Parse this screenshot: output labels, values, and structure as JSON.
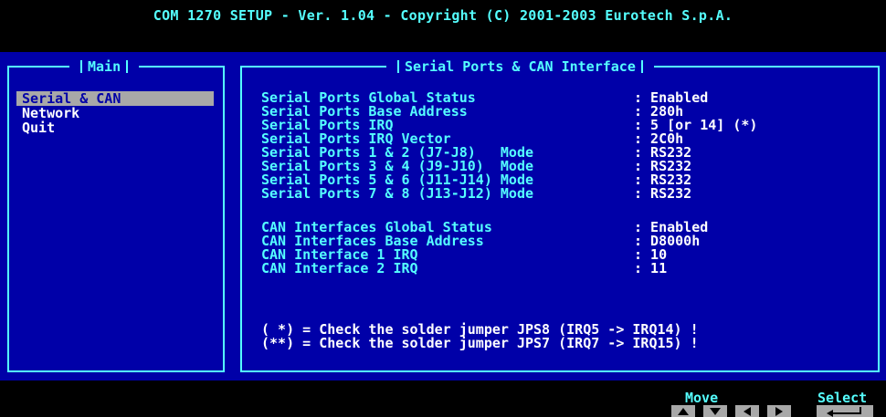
{
  "header": {
    "title": "COM 1270 SETUP - Ver. 1.04 - Copyright (C) 2001-2003 Eurotech S.p.A."
  },
  "main_panel": {
    "title": "Main",
    "items": [
      {
        "label": "Serial & CAN",
        "selected": true
      },
      {
        "label": "Network",
        "selected": false
      },
      {
        "label": "Quit",
        "selected": false
      }
    ]
  },
  "serial_panel": {
    "title": "Serial Ports & CAN Interface",
    "serial_rows": [
      {
        "label": "Serial Ports Global Status",
        "value": ": Enabled"
      },
      {
        "label": "Serial Ports Base Address",
        "value": ": 280h"
      },
      {
        "label": "Serial Ports IRQ",
        "value": ": 5 [or 14] (*)"
      },
      {
        "label": "Serial Ports IRQ Vector",
        "value": ": 2C0h"
      },
      {
        "label": "Serial Ports 1 & 2 (J7-J8)   Mode",
        "value": ": RS232"
      },
      {
        "label": "Serial Ports 3 & 4 (J9-J10)  Mode",
        "value": ": RS232"
      },
      {
        "label": "Serial Ports 5 & 6 (J11-J14) Mode",
        "value": ": RS232"
      },
      {
        "label": "Serial Ports 7 & 8 (J13-J12) Mode",
        "value": ": RS232"
      }
    ],
    "can_rows": [
      {
        "label": "CAN Interfaces Global Status",
        "value": ": Enabled"
      },
      {
        "label": "CAN Interfaces Base Address",
        "value": ": D8000h"
      },
      {
        "label": "CAN Interface 1 IRQ",
        "value": ": 10"
      },
      {
        "label": "CAN Interface 2 IRQ",
        "value": ": 11"
      }
    ],
    "notes": [
      "( *) = Check the solder jumper JPS8 (IRQ5 -> IRQ14) !",
      "(**) = Check the solder jumper JPS7 (IRQ7 -> IRQ15) !"
    ]
  },
  "footer": {
    "move_label": "Move",
    "select_label": "Select",
    "keys": [
      "arrow-up-icon",
      "arrow-down-icon",
      "arrow-left-icon",
      "arrow-right-icon",
      "enter-icon"
    ]
  },
  "colors": {
    "background": "#000000",
    "panel_blue": "#0000a8",
    "cyan": "#55ffff",
    "white": "#ffffff",
    "highlight": "#a8a8a8"
  }
}
